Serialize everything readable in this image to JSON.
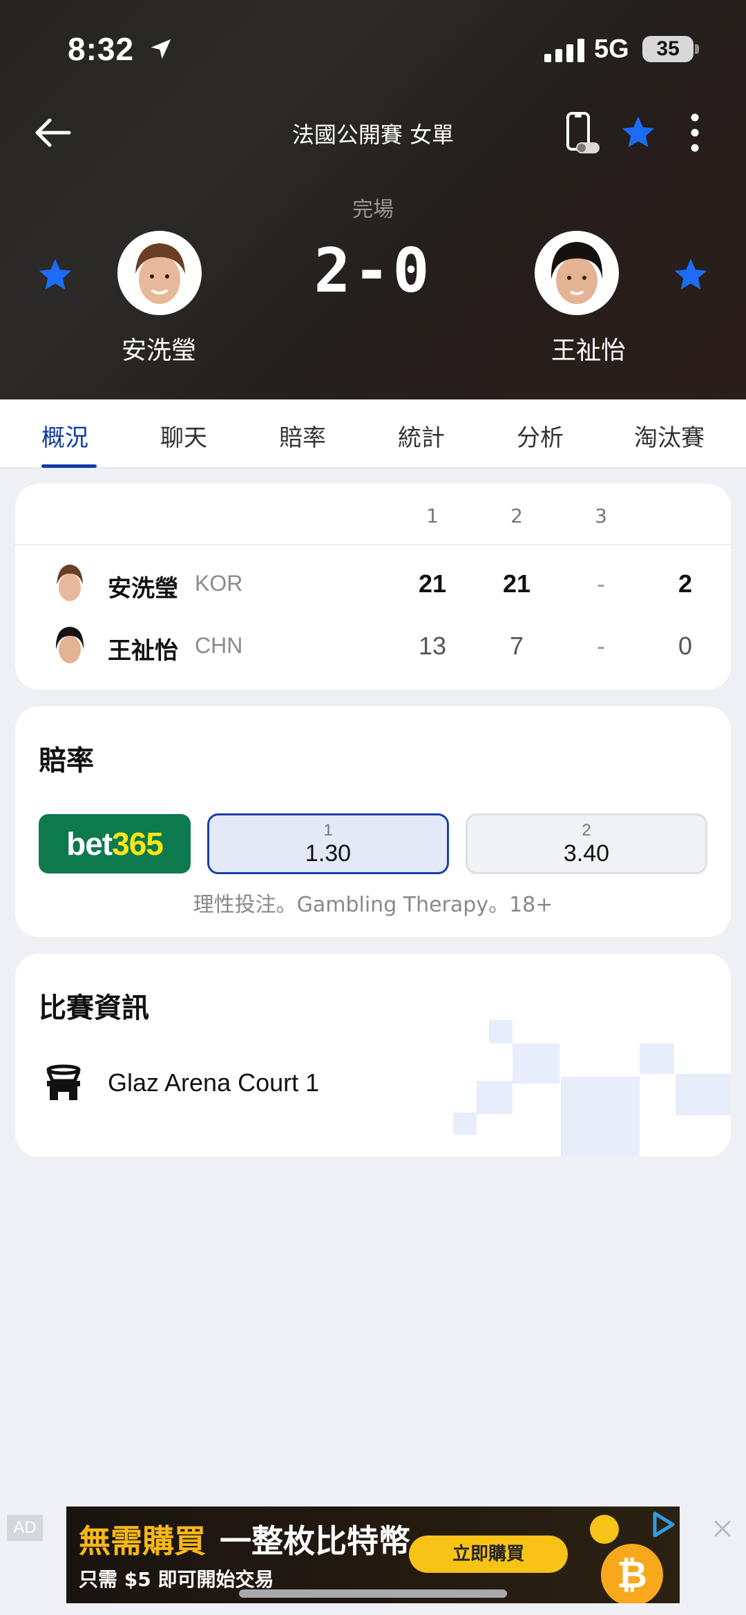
{
  "status_bar": {
    "time": "8:32",
    "network": "5G",
    "battery": "35"
  },
  "header": {
    "title": "法國公開賽 女單",
    "match_status": "完場",
    "score": "2-0",
    "player1": {
      "name": "安洗瑩"
    },
    "player2": {
      "name": "王祉怡"
    }
  },
  "tabs": [
    {
      "label": "概況",
      "active": true
    },
    {
      "label": "聊天"
    },
    {
      "label": "賠率"
    },
    {
      "label": "統計"
    },
    {
      "label": "分析"
    },
    {
      "label": "淘汰賽"
    }
  ],
  "scoreboard": {
    "set_headers": [
      "1",
      "2",
      "3"
    ],
    "rows": [
      {
        "name": "安洗瑩",
        "country": "KOR",
        "sets": [
          "21",
          "21",
          "-"
        ],
        "total": "2"
      },
      {
        "name": "王祉怡",
        "country": "CHN",
        "sets": [
          "13",
          "7",
          "-"
        ],
        "total": "0"
      }
    ]
  },
  "odds": {
    "title": "賠率",
    "bookmaker": {
      "part1": "bet",
      "part2": "365"
    },
    "options": [
      {
        "label": "1",
        "value": "1.30",
        "selected": true
      },
      {
        "label": "2",
        "value": "3.40"
      }
    ],
    "disclaimer": "理性投注。Gambling Therapy。18+"
  },
  "match_info": {
    "title": "比賽資訊",
    "venue": "Glaz Arena Court 1"
  },
  "ad": {
    "tag": "AD",
    "headline_highlight": "無需購買",
    "headline_rest": "一整枚比特幣",
    "sub": "只需 $5 即可開始交易",
    "cta": "立即購買",
    "coin": "₿"
  },
  "colors": {
    "accent": "#0f3ba8",
    "star": "#1d6cf5",
    "bet365_green": "#0c7a4c",
    "bet365_yellow": "#ffe617",
    "ad_gold": "#f6b818"
  },
  "icons": [
    "back-arrow-icon",
    "phone-icon",
    "star-icon",
    "more-icon",
    "location-arrow-icon",
    "signal-icon",
    "battery-icon",
    "stadium-icon",
    "close-icon",
    "adchoices-icon"
  ]
}
